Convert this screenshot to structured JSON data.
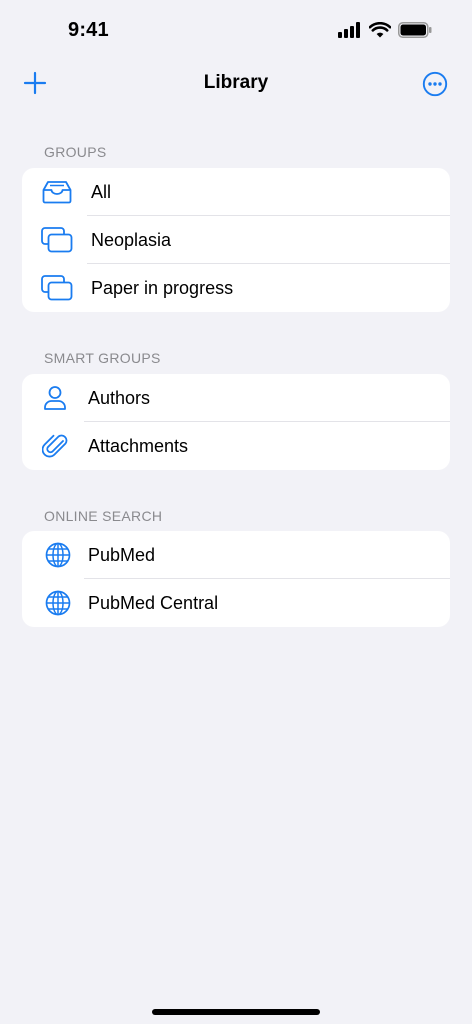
{
  "status_bar": {
    "time": "9:41"
  },
  "nav": {
    "title": "Library",
    "left_icon": "plus-icon",
    "right_icon": "ellipsis-circle-icon"
  },
  "accent_color": "#1a7cf0",
  "sections": [
    {
      "header": "GROUPS",
      "items": [
        {
          "label": "All",
          "icon": "tray-icon"
        },
        {
          "label": "Neoplasia",
          "icon": "folders-icon"
        },
        {
          "label": "Paper in progress",
          "icon": "folders-icon"
        }
      ]
    },
    {
      "header": "SMART GROUPS",
      "items": [
        {
          "label": "Authors",
          "icon": "person-icon"
        },
        {
          "label": "Attachments",
          "icon": "paperclip-icon"
        }
      ]
    },
    {
      "header": "ONLINE SEARCH",
      "items": [
        {
          "label": "PubMed",
          "icon": "globe-icon"
        },
        {
          "label": "PubMed Central",
          "icon": "globe-icon"
        }
      ]
    }
  ]
}
